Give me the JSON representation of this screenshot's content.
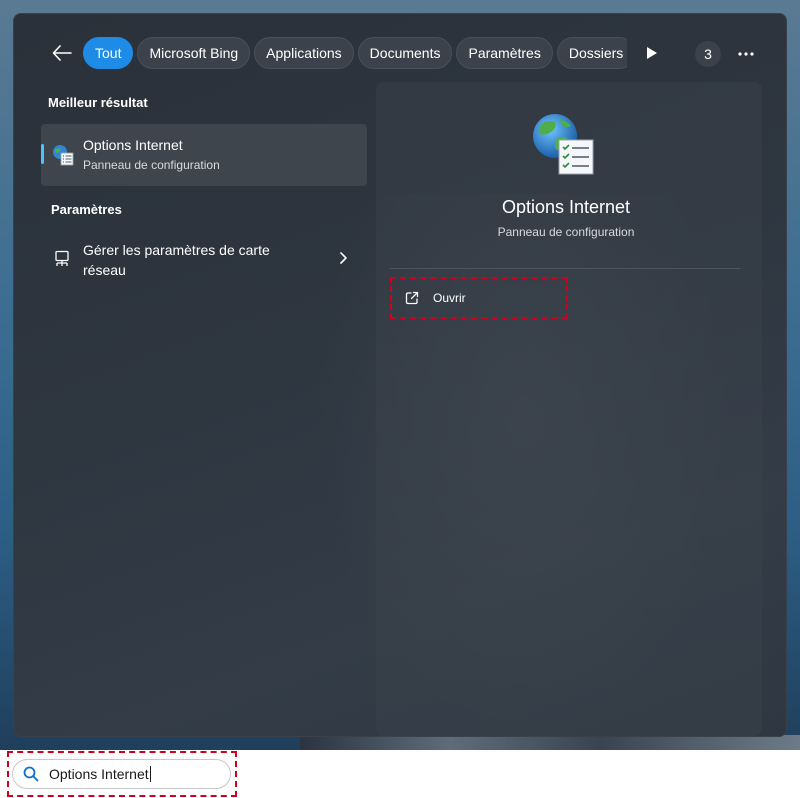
{
  "filters": {
    "items": [
      {
        "label": "Tout",
        "active": true
      },
      {
        "label": "Microsoft Bing",
        "active": false
      },
      {
        "label": "Applications",
        "active": false
      },
      {
        "label": "Documents",
        "active": false
      },
      {
        "label": "Paramètres",
        "active": false
      },
      {
        "label": "Dossiers",
        "active": false
      }
    ],
    "count": "3"
  },
  "results": {
    "best_heading": "Meilleur résultat",
    "best": {
      "title": "Options Internet",
      "subtitle": "Panneau de configuration",
      "icon": "internet-options-icon"
    },
    "settings_heading": "Paramètres",
    "settings": {
      "label": "Gérer les paramètres de carte réseau",
      "icon": "network-adapter-icon"
    }
  },
  "detail": {
    "title": "Options Internet",
    "subtitle": "Panneau de configuration",
    "open_label": "Ouvrir",
    "open_icon": "open-external-icon"
  },
  "taskbar": {
    "search_value": "Options Internet",
    "search_icon": "search-icon"
  },
  "colors": {
    "accent": "#1e8ce6",
    "highlight": "#d0021b",
    "selection_bar": "#4cc2ff"
  }
}
